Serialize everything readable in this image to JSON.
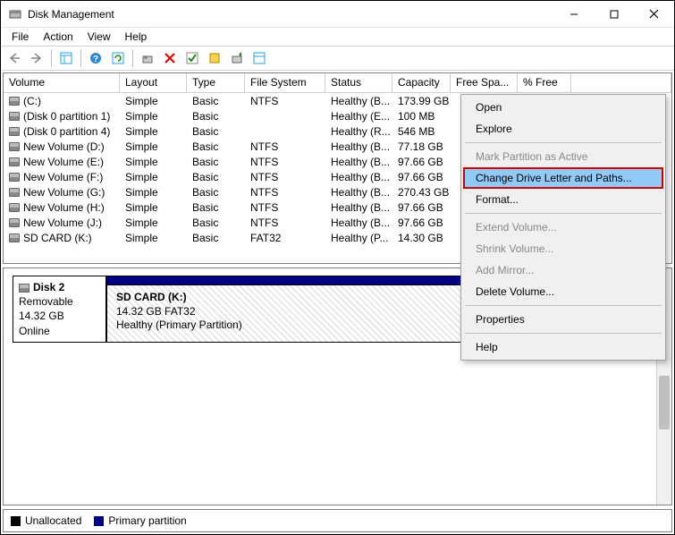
{
  "window": {
    "title": "Disk Management"
  },
  "menubar": [
    "File",
    "Action",
    "View",
    "Help"
  ],
  "columns": {
    "volume": "Volume",
    "layout": "Layout",
    "type": "Type",
    "fs": "File System",
    "status": "Status",
    "capacity": "Capacity",
    "free": "Free Spa...",
    "pfree": "% Free"
  },
  "volumes": [
    {
      "name": "(C:)",
      "layout": "Simple",
      "type": "Basic",
      "fs": "NTFS",
      "status": "Healthy (B...",
      "capacity": "173.99 GB"
    },
    {
      "name": "(Disk 0 partition 1)",
      "layout": "Simple",
      "type": "Basic",
      "fs": "",
      "status": "Healthy (E...",
      "capacity": "100 MB"
    },
    {
      "name": "(Disk 0 partition 4)",
      "layout": "Simple",
      "type": "Basic",
      "fs": "",
      "status": "Healthy (R...",
      "capacity": "546 MB"
    },
    {
      "name": "New Volume (D:)",
      "layout": "Simple",
      "type": "Basic",
      "fs": "NTFS",
      "status": "Healthy (B...",
      "capacity": "77.18 GB"
    },
    {
      "name": "New Volume (E:)",
      "layout": "Simple",
      "type": "Basic",
      "fs": "NTFS",
      "status": "Healthy (B...",
      "capacity": "97.66 GB"
    },
    {
      "name": "New Volume (F:)",
      "layout": "Simple",
      "type": "Basic",
      "fs": "NTFS",
      "status": "Healthy (B...",
      "capacity": "97.66 GB"
    },
    {
      "name": "New Volume (G:)",
      "layout": "Simple",
      "type": "Basic",
      "fs": "NTFS",
      "status": "Healthy (B...",
      "capacity": "270.43 GB"
    },
    {
      "name": "New Volume (H:)",
      "layout": "Simple",
      "type": "Basic",
      "fs": "NTFS",
      "status": "Healthy (B...",
      "capacity": "97.66 GB"
    },
    {
      "name": "New Volume (J:)",
      "layout": "Simple",
      "type": "Basic",
      "fs": "NTFS",
      "status": "Healthy (B...",
      "capacity": "97.66 GB"
    },
    {
      "name": "SD CARD (K:)",
      "layout": "Simple",
      "type": "Basic",
      "fs": "FAT32",
      "status": "Healthy (P...",
      "capacity": "14.30 GB"
    }
  ],
  "disk": {
    "label": "Disk 2",
    "removable": "Removable",
    "size": "14.32 GB",
    "state": "Online",
    "part_name": "SD CARD  (K:)",
    "part_size": "14.32 GB FAT32",
    "part_status": "Healthy (Primary Partition)"
  },
  "legend": {
    "unallocated": "Unallocated",
    "primary": "Primary partition"
  },
  "context_menu": {
    "open": "Open",
    "explore": "Explore",
    "mark_active": "Mark Partition as Active",
    "change_letter": "Change Drive Letter and Paths...",
    "format": "Format...",
    "extend": "Extend Volume...",
    "shrink": "Shrink Volume...",
    "add_mirror": "Add Mirror...",
    "delete": "Delete Volume...",
    "properties": "Properties",
    "help": "Help"
  }
}
